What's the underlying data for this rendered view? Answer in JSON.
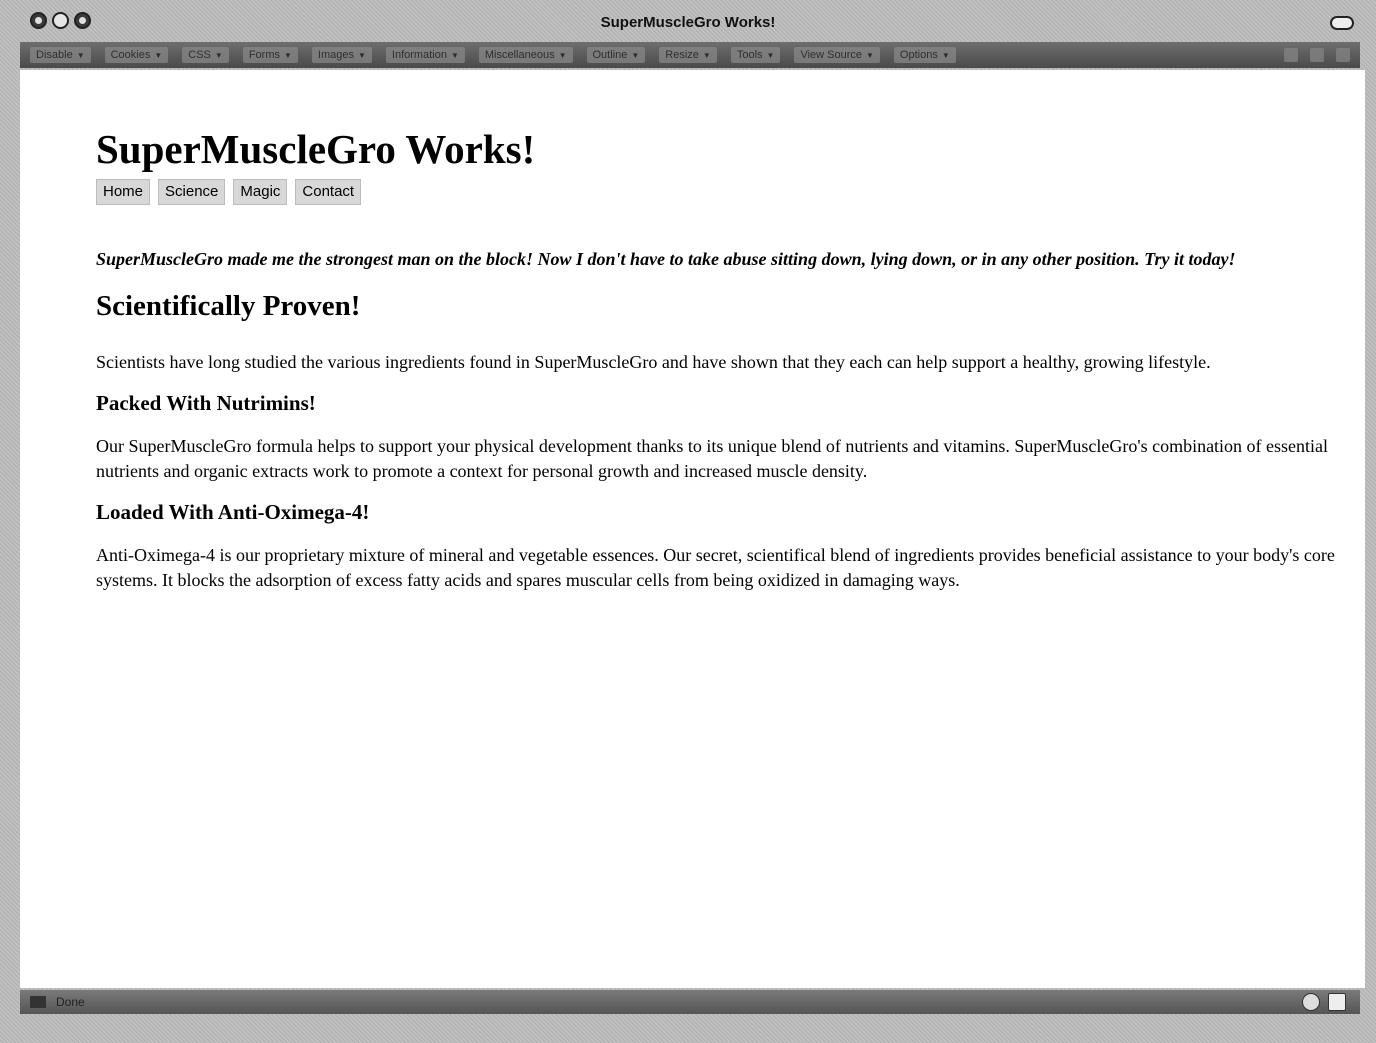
{
  "window": {
    "title": "SuperMuscleGro Works!"
  },
  "toolbar": {
    "items": [
      "Disable",
      "Cookies",
      "CSS",
      "Forms",
      "Images",
      "Information",
      "Miscellaneous",
      "Outline",
      "Resize",
      "Tools",
      "View Source",
      "Options"
    ]
  },
  "page": {
    "heading": "SuperMuscleGro Works!",
    "nav": [
      "Home",
      "Science",
      "Magic",
      "Contact"
    ],
    "tagline": "SuperMuscleGro made me the strongest man on the block! Now I don't have to take abuse sitting down, lying down, or in any other position. Try it today!",
    "section1": {
      "heading": "Scientifically Proven!",
      "text": "Scientists have long studied the various ingredients found in SuperMuscleGro and have shown that they each can help support a healthy, growing lifestyle."
    },
    "section2": {
      "heading": "Packed With Nutrimins!",
      "text": "Our SuperMuscleGro formula helps to support your physical development thanks to its unique blend of nutrients and vitamins. SuperMuscleGro's combination of essential nutrients and organic extracts work to promote a context for personal growth and increased muscle density."
    },
    "section3": {
      "heading": "Loaded With Anti-Oximega-4!",
      "text": "Anti-Oximega-4 is our proprietary mixture of mineral and vegetable essences. Our secret, scientifical blend of ingredients provides beneficial assistance to your body's core systems. It blocks the adsorption of excess fatty acids and spares muscular cells from being oxidized in damaging ways."
    }
  },
  "status": {
    "text": "Done"
  }
}
